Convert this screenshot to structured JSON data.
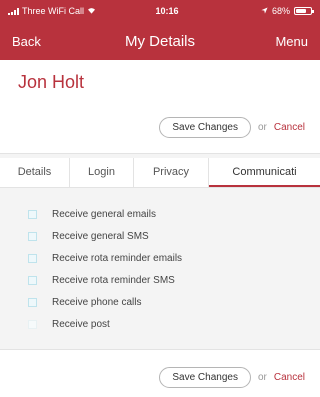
{
  "status_bar": {
    "carrier": "Three WiFi Call",
    "time": "10:16",
    "battery_text": "68%",
    "battery_level": 0.68
  },
  "nav": {
    "back": "Back",
    "title": "My Details",
    "menu": "Menu"
  },
  "user": {
    "name": "Jon Holt"
  },
  "actions": {
    "save": "Save Changes",
    "or": "or",
    "cancel": "Cancel"
  },
  "tabs": [
    {
      "label": "Details"
    },
    {
      "label": "Login"
    },
    {
      "label": "Privacy"
    },
    {
      "label": "Communicati",
      "active": true
    }
  ],
  "options": [
    {
      "label": "Receive general emails",
      "checked": false
    },
    {
      "label": "Receive general SMS",
      "checked": false
    },
    {
      "label": "Receive rota reminder emails",
      "checked": false
    },
    {
      "label": "Receive rota reminder SMS",
      "checked": false
    },
    {
      "label": "Receive phone calls",
      "checked": false
    },
    {
      "label": "Receive post",
      "checked": false
    }
  ],
  "colors": {
    "brand": "#b8323d",
    "checkbox_border": "#bfe3ec"
  }
}
